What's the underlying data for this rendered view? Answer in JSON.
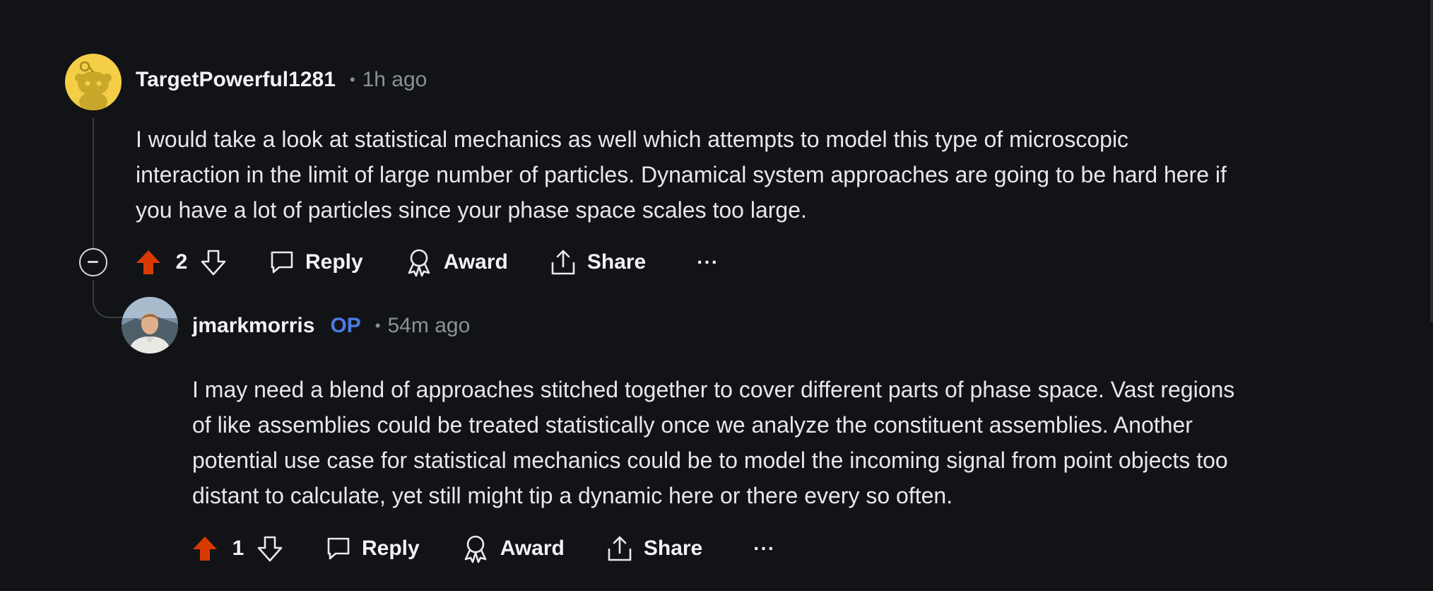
{
  "comments": [
    {
      "username": "TargetPowerful1281",
      "separator": "•",
      "time": "1h ago",
      "body_lines": [
        "I would take a look at statistical mechanics as well which attempts to model this type of microscopic",
        "interaction in the limit of large number of particles. Dynamical system approaches are going to be hard here if",
        "you have a lot of particles since your phase space scales too large."
      ],
      "vote_count": "2",
      "upvoted": true,
      "actions": {
        "reply": "Reply",
        "award": "Award",
        "share": "Share",
        "more": "···"
      }
    },
    {
      "username": "jmarkmorris",
      "op_badge": "OP",
      "separator": "•",
      "time": "54m ago",
      "body_lines": [
        "I may need a blend of approaches stitched together to cover different parts of phase space. Vast regions",
        "of like assemblies could be treated statistically once we analyze the constituent assemblies. Another",
        "potential use case for statistical mechanics could be to model the incoming signal from point objects too",
        "distant to calculate, yet still might tip a dynamic here or there every so often."
      ],
      "vote_count": "1",
      "upvoted": true,
      "actions": {
        "reply": "Reply",
        "award": "Award",
        "share": "Share",
        "more": "···"
      }
    }
  ],
  "colors": {
    "background": "#121316",
    "upvote_active": "#d93a00",
    "op_badge": "#4a7be0",
    "muted_text": "#8b9098",
    "avatar_snoo_bg": "#f3ce46"
  },
  "icons": [
    "snoo-avatar-icon",
    "collapse-icon",
    "upvote-icon",
    "downvote-icon",
    "comment-icon",
    "award-icon",
    "share-icon"
  ]
}
